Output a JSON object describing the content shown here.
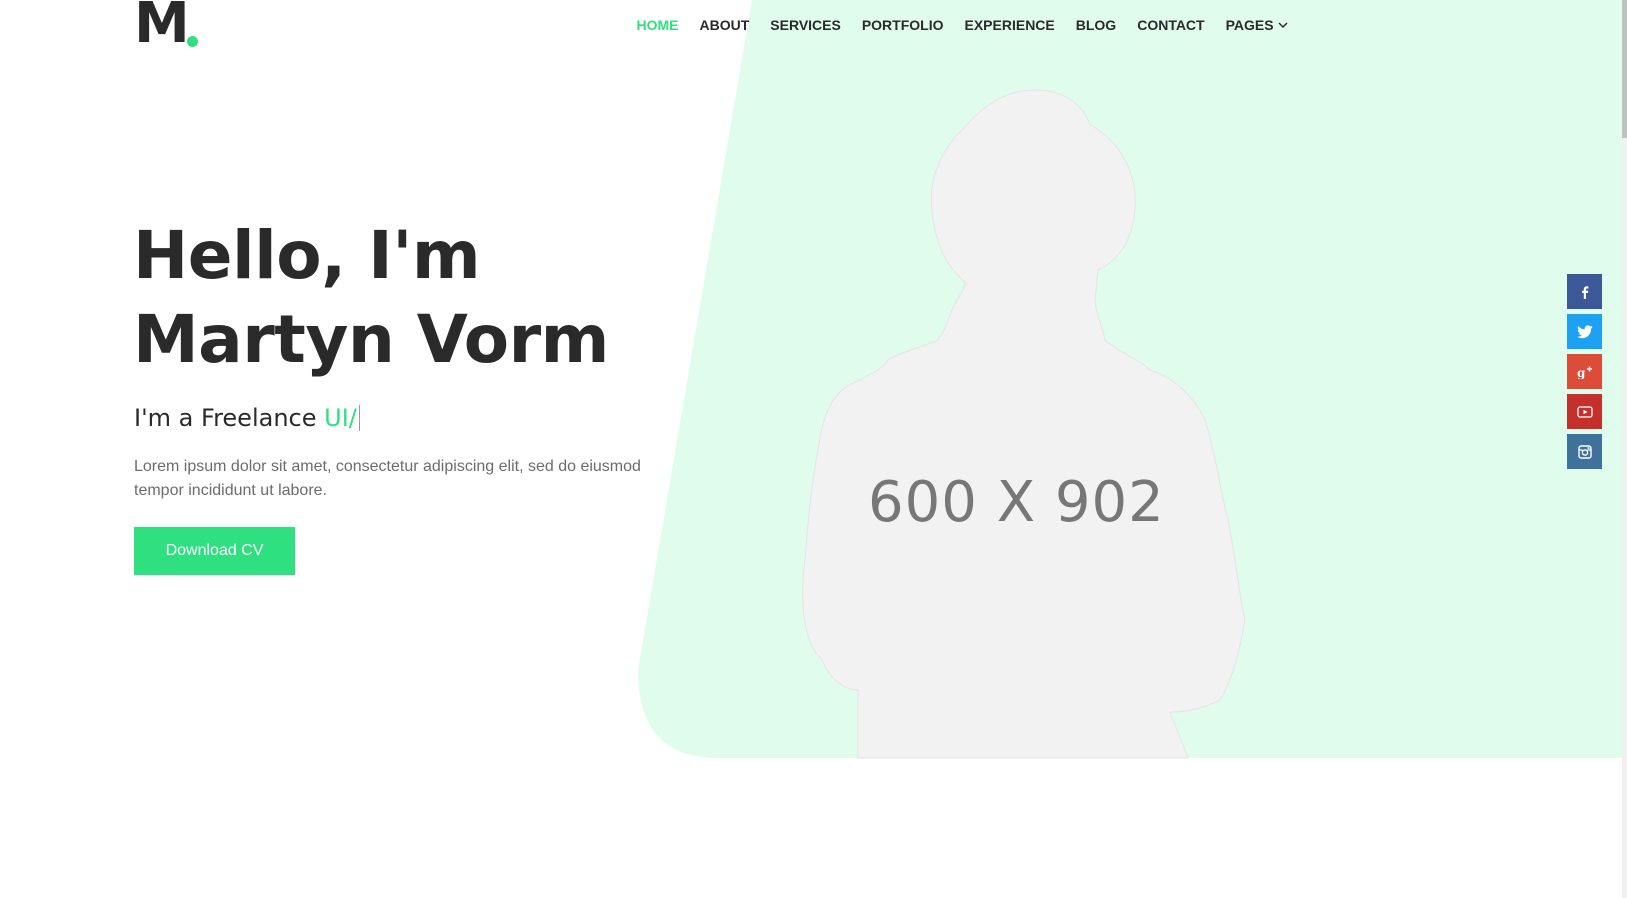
{
  "brand": {
    "logo_text": "M",
    "accent_color": "#2ee07f",
    "hero_bg_color": "#e0fcec"
  },
  "nav": {
    "items": [
      {
        "label": "HOME",
        "active": true
      },
      {
        "label": "ABOUT",
        "active": false
      },
      {
        "label": "SERVICES",
        "active": false
      },
      {
        "label": "PORTFOLIO",
        "active": false
      },
      {
        "label": "EXPERIENCE",
        "active": false
      },
      {
        "label": "BLOG",
        "active": false
      },
      {
        "label": "CONTACT",
        "active": false
      },
      {
        "label": "PAGES",
        "active": false,
        "has_dropdown": true
      }
    ]
  },
  "hero": {
    "title_line1": "Hello, I'm",
    "title_line2": "Martyn Vorm",
    "subtitle_prefix": "I'm a Freelance ",
    "subtitle_typed": "UI/",
    "description": "Lorem ipsum dolor sit amet, consectetur adipiscing elit, sed do eiusmod tempor incididunt ut labore.",
    "cta_label": "Download CV",
    "image_placeholder": "600 X 902"
  },
  "social": {
    "items": [
      {
        "name": "facebook",
        "glyph": "f"
      },
      {
        "name": "twitter",
        "glyph": "t"
      },
      {
        "name": "google-plus",
        "glyph": "g+"
      },
      {
        "name": "youtube",
        "glyph": "yt"
      },
      {
        "name": "instagram",
        "glyph": "ig"
      }
    ]
  }
}
